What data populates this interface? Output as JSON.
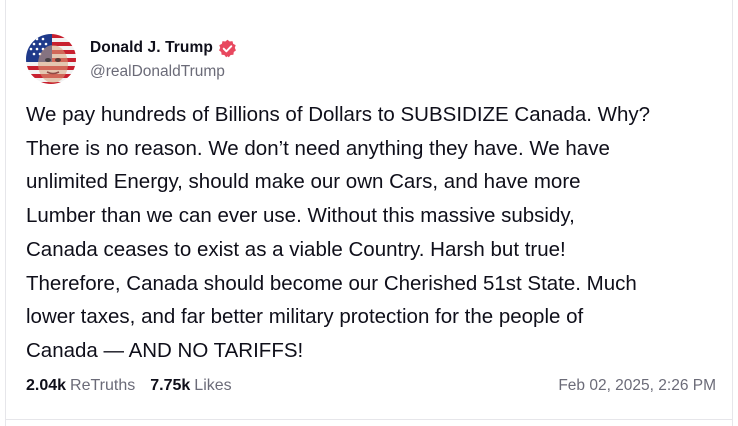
{
  "post": {
    "author": {
      "display_name": "Donald J. Trump",
      "handle": "@realDonaldTrump",
      "verified": true,
      "avatar_icon": "flag-face-avatar"
    },
    "body_lines": [
      "We pay hundreds of Billions of Dollars to SUBSIDIZE Canada. Why?",
      "There is no reason. We don’t need anything they have. We have",
      "unlimited Energy, should make our own Cars, and have more",
      "Lumber than we can ever use. Without this massive subsidy,",
      "Canada ceases to exist as a viable Country. Harsh but true!",
      "Therefore, Canada should become our Cherished 51st State. Much",
      "lower taxes, and far better military protection for the people of",
      "Canada — AND NO TARIFFS!"
    ],
    "stats": {
      "retruths_count": "2.04k",
      "retruths_label": "ReTruths",
      "likes_count": "7.75k",
      "likes_label": "Likes"
    },
    "timestamp": "Feb 02, 2025, 2:26 PM"
  },
  "colors": {
    "verified_badge": "#e8485f",
    "text_primary": "#0f0f1a",
    "text_secondary": "#6b6b78",
    "divider": "#e6e6ea"
  }
}
